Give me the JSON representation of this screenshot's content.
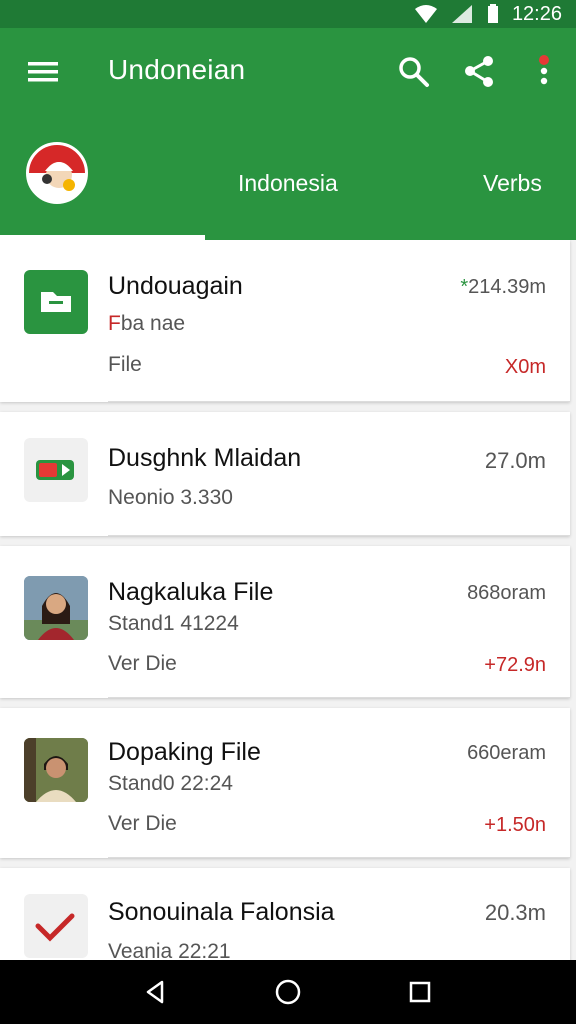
{
  "status_bar": {
    "time": "12:26"
  },
  "appbar": {
    "title": "Undoneian",
    "tabs": [
      {
        "label": "Indonesia"
      },
      {
        "label": "Verbs"
      }
    ]
  },
  "items": [
    {
      "title": "Undouagain",
      "subtitle": "Fba nae",
      "subtitle_prefix": "F",
      "detail": "File",
      "right_top": "*214.39m",
      "right_bottom": "X0m",
      "icon": "folder-icon",
      "icon_color": "#2a9440"
    },
    {
      "title": "Dusghnk Mlaidan",
      "subtitle": "Neonio 3.330",
      "detail": "",
      "right_top": "27.0m",
      "right_bottom": "",
      "icon": "video-file-icon",
      "icon_color": "#2a9440"
    },
    {
      "title": "Nagkaluka File",
      "subtitle": "Stand1 41224",
      "detail": "Ver Die",
      "right_top": "868oram",
      "right_bottom": "+72.9n",
      "icon": "woman-avatar",
      "icon_color": "#8a4b2d"
    },
    {
      "title": "Dopaking File",
      "subtitle": "Stand0 22:24",
      "detail": "Ver Die",
      "right_top": "660eram",
      "right_bottom": "+1.50n",
      "icon": "man-avatar",
      "icon_color": "#6b5a3a"
    },
    {
      "title": "Sonouinala Falonsia",
      "subtitle": "Veania 22:21",
      "detail": "",
      "right_top": "20.3m",
      "right_bottom": "",
      "icon": "checkmark-icon",
      "icon_color": "#c62828"
    }
  ],
  "colors": {
    "primary": "#2a9440",
    "primary_dark": "#1f7a35",
    "accent_red": "#c62828"
  }
}
